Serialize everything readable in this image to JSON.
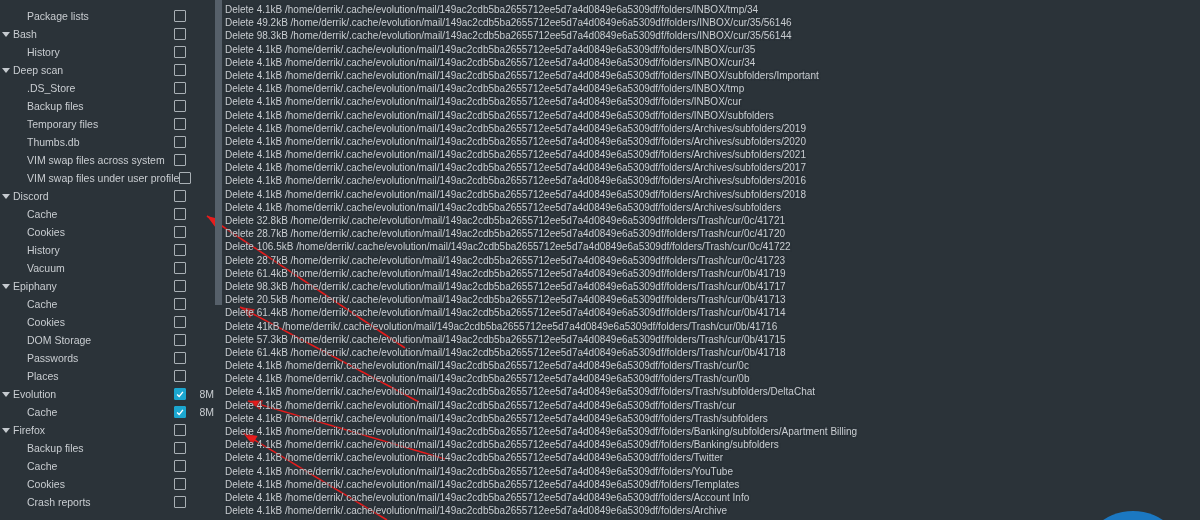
{
  "sidebar": {
    "items": [
      {
        "children": [
          {
            "label": "Package lists",
            "checked": false
          }
        ]
      },
      {
        "label": "Bash",
        "expanded": true,
        "checked": false,
        "children": [
          {
            "label": "History",
            "checked": false
          }
        ]
      },
      {
        "label": "Deep scan",
        "expanded": true,
        "checked": false,
        "children": [
          {
            "label": ".DS_Store",
            "checked": false
          },
          {
            "label": "Backup files",
            "checked": false
          },
          {
            "label": "Temporary files",
            "checked": false
          },
          {
            "label": "Thumbs.db",
            "checked": false
          },
          {
            "label": "VIM swap files across system",
            "checked": false
          },
          {
            "label": "VIM swap files under user profile",
            "checked": false
          }
        ]
      },
      {
        "label": "Discord",
        "expanded": true,
        "checked": false,
        "children": [
          {
            "label": "Cache",
            "checked": false
          },
          {
            "label": "Cookies",
            "checked": false
          },
          {
            "label": "History",
            "checked": false
          },
          {
            "label": "Vacuum",
            "checked": false
          }
        ]
      },
      {
        "label": "Epiphany",
        "expanded": true,
        "checked": false,
        "children": [
          {
            "label": "Cache",
            "checked": false
          },
          {
            "label": "Cookies",
            "checked": false
          },
          {
            "label": "DOM Storage",
            "checked": false
          },
          {
            "label": "Passwords",
            "checked": false
          },
          {
            "label": "Places",
            "checked": false
          }
        ]
      },
      {
        "label": "Evolution",
        "expanded": true,
        "checked": true,
        "size": "8M",
        "children": [
          {
            "label": "Cache",
            "checked": true,
            "size": "8M"
          }
        ]
      },
      {
        "label": "Firefox",
        "expanded": true,
        "checked": false,
        "children": [
          {
            "label": "Backup files",
            "checked": false
          },
          {
            "label": "Cache",
            "checked": false
          },
          {
            "label": "Cookies",
            "checked": false
          },
          {
            "label": "Crash reports",
            "checked": false
          }
        ]
      }
    ]
  },
  "log": {
    "lines": [
      "Delete 4.1kB /home/derrik/.cache/evolution/mail/149ac2cdb5ba2655712ee5d7a4d0849e6a5309df/folders/INBOX/tmp/34",
      "Delete 49.2kB /home/derrik/.cache/evolution/mail/149ac2cdb5ba2655712ee5d7a4d0849e6a5309df/folders/INBOX/cur/35/56146",
      "Delete 98.3kB /home/derrik/.cache/evolution/mail/149ac2cdb5ba2655712ee5d7a4d0849e6a5309df/folders/INBOX/cur/35/56144",
      "Delete 4.1kB /home/derrik/.cache/evolution/mail/149ac2cdb5ba2655712ee5d7a4d0849e6a5309df/folders/INBOX/cur/35",
      "Delete 4.1kB /home/derrik/.cache/evolution/mail/149ac2cdb5ba2655712ee5d7a4d0849e6a5309df/folders/INBOX/cur/34",
      "Delete 4.1kB /home/derrik/.cache/evolution/mail/149ac2cdb5ba2655712ee5d7a4d0849e6a5309df/folders/INBOX/subfolders/Important",
      "Delete 4.1kB /home/derrik/.cache/evolution/mail/149ac2cdb5ba2655712ee5d7a4d0849e6a5309df/folders/INBOX/tmp",
      "Delete 4.1kB /home/derrik/.cache/evolution/mail/149ac2cdb5ba2655712ee5d7a4d0849e6a5309df/folders/INBOX/cur",
      "Delete 4.1kB /home/derrik/.cache/evolution/mail/149ac2cdb5ba2655712ee5d7a4d0849e6a5309df/folders/INBOX/subfolders",
      "Delete 4.1kB /home/derrik/.cache/evolution/mail/149ac2cdb5ba2655712ee5d7a4d0849e6a5309df/folders/Archives/subfolders/2019",
      "Delete 4.1kB /home/derrik/.cache/evolution/mail/149ac2cdb5ba2655712ee5d7a4d0849e6a5309df/folders/Archives/subfolders/2020",
      "Delete 4.1kB /home/derrik/.cache/evolution/mail/149ac2cdb5ba2655712ee5d7a4d0849e6a5309df/folders/Archives/subfolders/2021",
      "Delete 4.1kB /home/derrik/.cache/evolution/mail/149ac2cdb5ba2655712ee5d7a4d0849e6a5309df/folders/Archives/subfolders/2017",
      "Delete 4.1kB /home/derrik/.cache/evolution/mail/149ac2cdb5ba2655712ee5d7a4d0849e6a5309df/folders/Archives/subfolders/2016",
      "Delete 4.1kB /home/derrik/.cache/evolution/mail/149ac2cdb5ba2655712ee5d7a4d0849e6a5309df/folders/Archives/subfolders/2018",
      "Delete 4.1kB /home/derrik/.cache/evolution/mail/149ac2cdb5ba2655712ee5d7a4d0849e6a5309df/folders/Archives/subfolders",
      "Delete 32.8kB /home/derrik/.cache/evolution/mail/149ac2cdb5ba2655712ee5d7a4d0849e6a5309df/folders/Trash/cur/0c/41721",
      "Delete 28.7kB /home/derrik/.cache/evolution/mail/149ac2cdb5ba2655712ee5d7a4d0849e6a5309df/folders/Trash/cur/0c/41720",
      "Delete 106.5kB /home/derrik/.cache/evolution/mail/149ac2cdb5ba2655712ee5d7a4d0849e6a5309df/folders/Trash/cur/0c/41722",
      "Delete 28.7kB /home/derrik/.cache/evolution/mail/149ac2cdb5ba2655712ee5d7a4d0849e6a5309df/folders/Trash/cur/0c/41723",
      "Delete 61.4kB /home/derrik/.cache/evolution/mail/149ac2cdb5ba2655712ee5d7a4d0849e6a5309df/folders/Trash/cur/0b/41719",
      "Delete 98.3kB /home/derrik/.cache/evolution/mail/149ac2cdb5ba2655712ee5d7a4d0849e6a5309df/folders/Trash/cur/0b/41717",
      "Delete 20.5kB /home/derrik/.cache/evolution/mail/149ac2cdb5ba2655712ee5d7a4d0849e6a5309df/folders/Trash/cur/0b/41713",
      "Delete 61.4kB /home/derrik/.cache/evolution/mail/149ac2cdb5ba2655712ee5d7a4d0849e6a5309df/folders/Trash/cur/0b/41714",
      "Delete 41kB /home/derrik/.cache/evolution/mail/149ac2cdb5ba2655712ee5d7a4d0849e6a5309df/folders/Trash/cur/0b/41716",
      "Delete 57.3kB /home/derrik/.cache/evolution/mail/149ac2cdb5ba2655712ee5d7a4d0849e6a5309df/folders/Trash/cur/0b/41715",
      "Delete 61.4kB /home/derrik/.cache/evolution/mail/149ac2cdb5ba2655712ee5d7a4d0849e6a5309df/folders/Trash/cur/0b/41718",
      "Delete 4.1kB /home/derrik/.cache/evolution/mail/149ac2cdb5ba2655712ee5d7a4d0849e6a5309df/folders/Trash/cur/0c",
      "Delete 4.1kB /home/derrik/.cache/evolution/mail/149ac2cdb5ba2655712ee5d7a4d0849e6a5309df/folders/Trash/cur/0b",
      "Delete 4.1kB /home/derrik/.cache/evolution/mail/149ac2cdb5ba2655712ee5d7a4d0849e6a5309df/folders/Trash/subfolders/DeltaChat",
      "Delete 4.1kB /home/derrik/.cache/evolution/mail/149ac2cdb5ba2655712ee5d7a4d0849e6a5309df/folders/Trash/cur",
      "Delete 4.1kB /home/derrik/.cache/evolution/mail/149ac2cdb5ba2655712ee5d7a4d0849e6a5309df/folders/Trash/subfolders",
      "Delete 4.1kB /home/derrik/.cache/evolution/mail/149ac2cdb5ba2655712ee5d7a4d0849e6a5309df/folders/Banking/subfolders/Apartment Billing",
      "Delete 4.1kB /home/derrik/.cache/evolution/mail/149ac2cdb5ba2655712ee5d7a4d0849e6a5309df/folders/Banking/subfolders",
      "Delete 4.1kB /home/derrik/.cache/evolution/mail/149ac2cdb5ba2655712ee5d7a4d0849e6a5309df/folders/Twitter",
      "Delete 4.1kB /home/derrik/.cache/evolution/mail/149ac2cdb5ba2655712ee5d7a4d0849e6a5309df/folders/YouTube",
      "Delete 4.1kB /home/derrik/.cache/evolution/mail/149ac2cdb5ba2655712ee5d7a4d0849e6a5309df/folders/Templates",
      "Delete 4.1kB /home/derrik/.cache/evolution/mail/149ac2cdb5ba2655712ee5d7a4d0849e6a5309df/folders/Account Info",
      "Delete 4.1kB /home/derrik/.cache/evolution/mail/149ac2cdb5ba2655712ee5d7a4d0849e6a5309df/folders/Archive"
    ]
  }
}
